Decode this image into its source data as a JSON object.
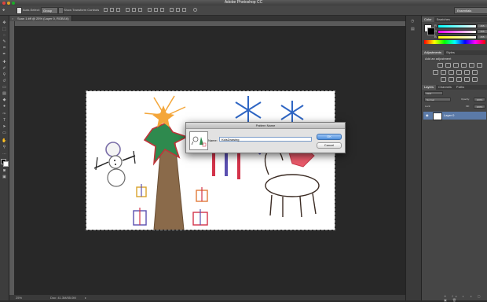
{
  "app": {
    "title": "Adobe Photoshop CC"
  },
  "options": {
    "auto_select": "Auto-Select:",
    "group": "Group",
    "show_transform": "Show Transform Controls",
    "workspace": "Essentials"
  },
  "document": {
    "tab_label": "Scan 1.tiff @ 25% (Layer 0, RGB/16)",
    "zoom": "25%",
    "doc_size": "Doc: 41.3M/55.0M"
  },
  "panels": {
    "color_tabs": [
      "Color",
      "Swatches"
    ],
    "color_values": {
      "r_label": "R",
      "g_label": "G",
      "b_label": "B",
      "r": "255",
      "g": "255",
      "b": "255"
    },
    "adjustment_tabs": [
      "Adjustments",
      "Styles"
    ],
    "add_adjustment": "Add an adjustment",
    "layers_tabs": [
      "Layers",
      "Channels",
      "Paths"
    ],
    "kind_label": "Kind",
    "blend_mode": "Normal",
    "opacity_label": "Opacity:",
    "opacity": "100%",
    "lock_label": "Lock:",
    "fill_label": "Fill:",
    "fill": "100%",
    "layer_name": "Layer 0"
  },
  "dialog": {
    "title": "Pattern Name",
    "name_label": "Name:",
    "name_value": "KidsDrawing",
    "ok": "OK",
    "cancel": "Cancel"
  },
  "colors": {
    "accent": "#4f8fdc",
    "canvas_bg": "#282828",
    "panel_bg": "#464646"
  }
}
